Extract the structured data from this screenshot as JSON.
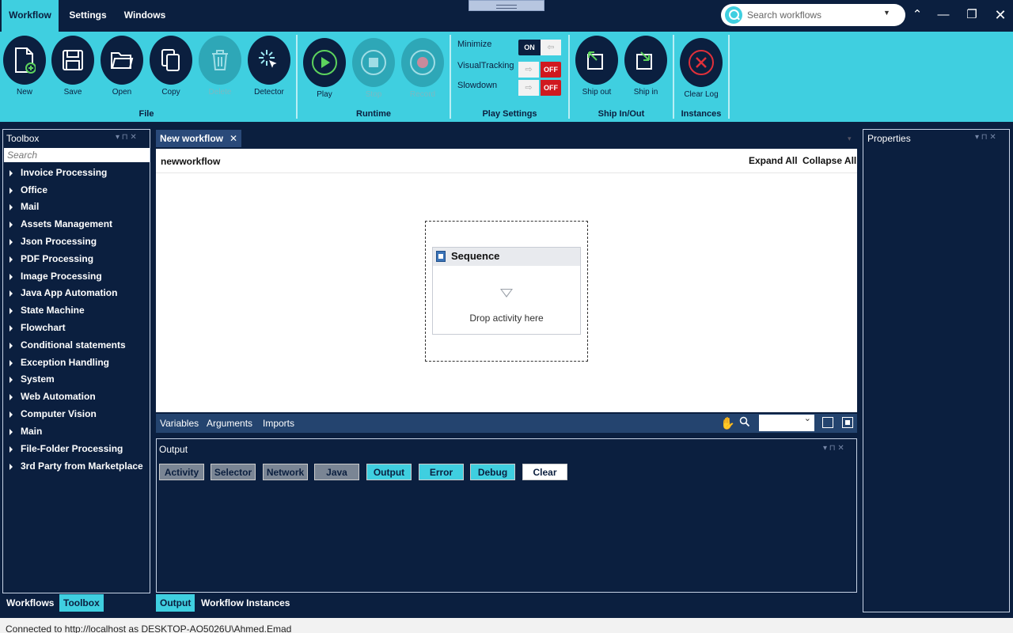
{
  "menu": {
    "tabs": [
      "Workflow",
      "Settings",
      "Windows"
    ]
  },
  "search": {
    "placeholder": "Search workflows"
  },
  "ribbon": {
    "file_buttons": [
      "New",
      "Save",
      "Open",
      "Copy",
      "Delete",
      "Detector"
    ],
    "runtime_buttons": [
      "Play",
      "Stop",
      "Record"
    ],
    "ship_buttons": [
      "Ship out",
      "Ship in"
    ],
    "instances_buttons": [
      "Clear Log"
    ],
    "groups": [
      "File",
      "Runtime",
      "Play Settings",
      "Ship In/Out",
      "Instances"
    ],
    "play_settings": [
      {
        "label": "Minimize",
        "state": "ON"
      },
      {
        "label": "VisualTracking",
        "state": "OFF"
      },
      {
        "label": "Slowdown",
        "state": "OFF"
      }
    ]
  },
  "toolbox": {
    "title": "Toolbox",
    "search_placeholder": "Search",
    "items": [
      "Invoice Processing",
      "Office",
      "Mail",
      "Assets Management",
      "Json Processing",
      "PDF Processing",
      "Image Processing",
      "Java App Automation",
      "State Machine",
      "Flowchart",
      "Conditional statements",
      "Exception Handling",
      "System",
      "Web Automation",
      "Computer Vision",
      "Main",
      "File-Folder Processing",
      "3rd Party from Marketplace"
    ],
    "bottom_tabs": [
      "Workflows",
      "Toolbox"
    ]
  },
  "designer": {
    "tab": "New workflow",
    "breadcrumb": "newworkflow",
    "expand_all": "Expand All",
    "collapse_all": "Collapse All",
    "sequence_title": "Sequence",
    "drop_text": "Drop activity here",
    "bottom_links": [
      "Variables",
      "Arguments",
      "Imports"
    ]
  },
  "output": {
    "title": "Output",
    "filters": [
      "Activity",
      "Selector",
      "Network",
      "Java",
      "Output",
      "Error",
      "Debug",
      "Clear"
    ],
    "bottom_tabs": [
      "Output",
      "Workflow Instances"
    ]
  },
  "properties": {
    "title": "Properties"
  },
  "status": "Connected to http://localhost as DESKTOP-AO5026U\\Ahmed.Emad",
  "colors": {
    "accent": "#3fcfe0",
    "navy": "#0b1f3f",
    "off_red": "#d0191f"
  }
}
